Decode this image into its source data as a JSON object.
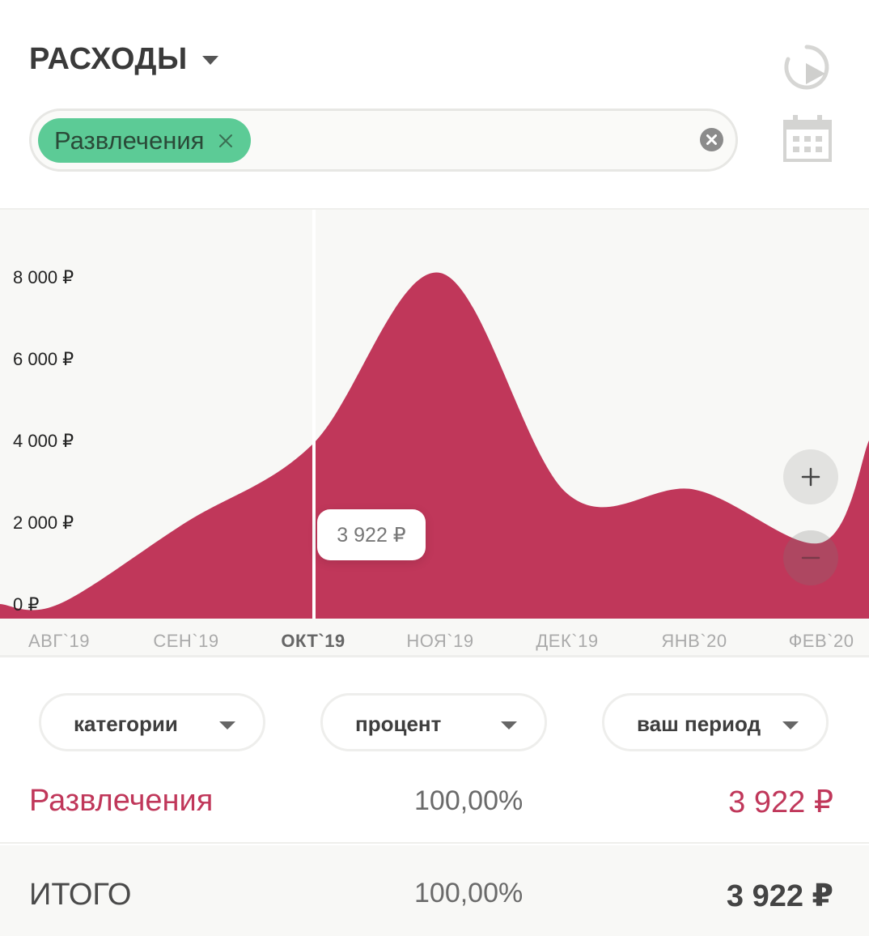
{
  "header": {
    "title": "РАСХОДЫ",
    "icons": {
      "chart_button": "chart-play-icon",
      "calendar_button": "calendar-icon"
    }
  },
  "filter": {
    "chip_label": "Развлечения",
    "chip_color": "#5ccb96",
    "clear_icon": "clear-circle-icon"
  },
  "chart_data": {
    "type": "area",
    "x": [
      "АВГ`19",
      "СЕН`19",
      "ОКТ`19",
      "НОЯ`19",
      "ДЕК`19",
      "ЯНВ`20",
      "ФЕВ`20"
    ],
    "values": [
      0,
      2000,
      3922,
      8100,
      2700,
      2800,
      1500
    ],
    "y_ticks": [
      "8 000 ₽",
      "6 000 ₽",
      "4 000 ₽",
      "2 000 ₽",
      "0 ₽"
    ],
    "ylim": [
      0,
      10000
    ],
    "selected_index": 2,
    "selected_label": "3 922 ₽",
    "color": "#c0375a",
    "grid": false
  },
  "zoom": {
    "in_icon": "plus-icon",
    "out_icon": "minus-icon"
  },
  "controls": {
    "category_label": "категории",
    "percent_label": "процент",
    "period_label": "ваш период"
  },
  "rows": {
    "category": {
      "name": "Развлечения",
      "percent": "100,00%",
      "amount": "3 922 ₽"
    },
    "total": {
      "name": "ИТОГО",
      "percent": "100,00%",
      "amount": "3 922 ₽"
    }
  },
  "colors": {
    "accent": "#c0375a",
    "chip": "#5ccb96",
    "background": "#f8f8f6"
  }
}
